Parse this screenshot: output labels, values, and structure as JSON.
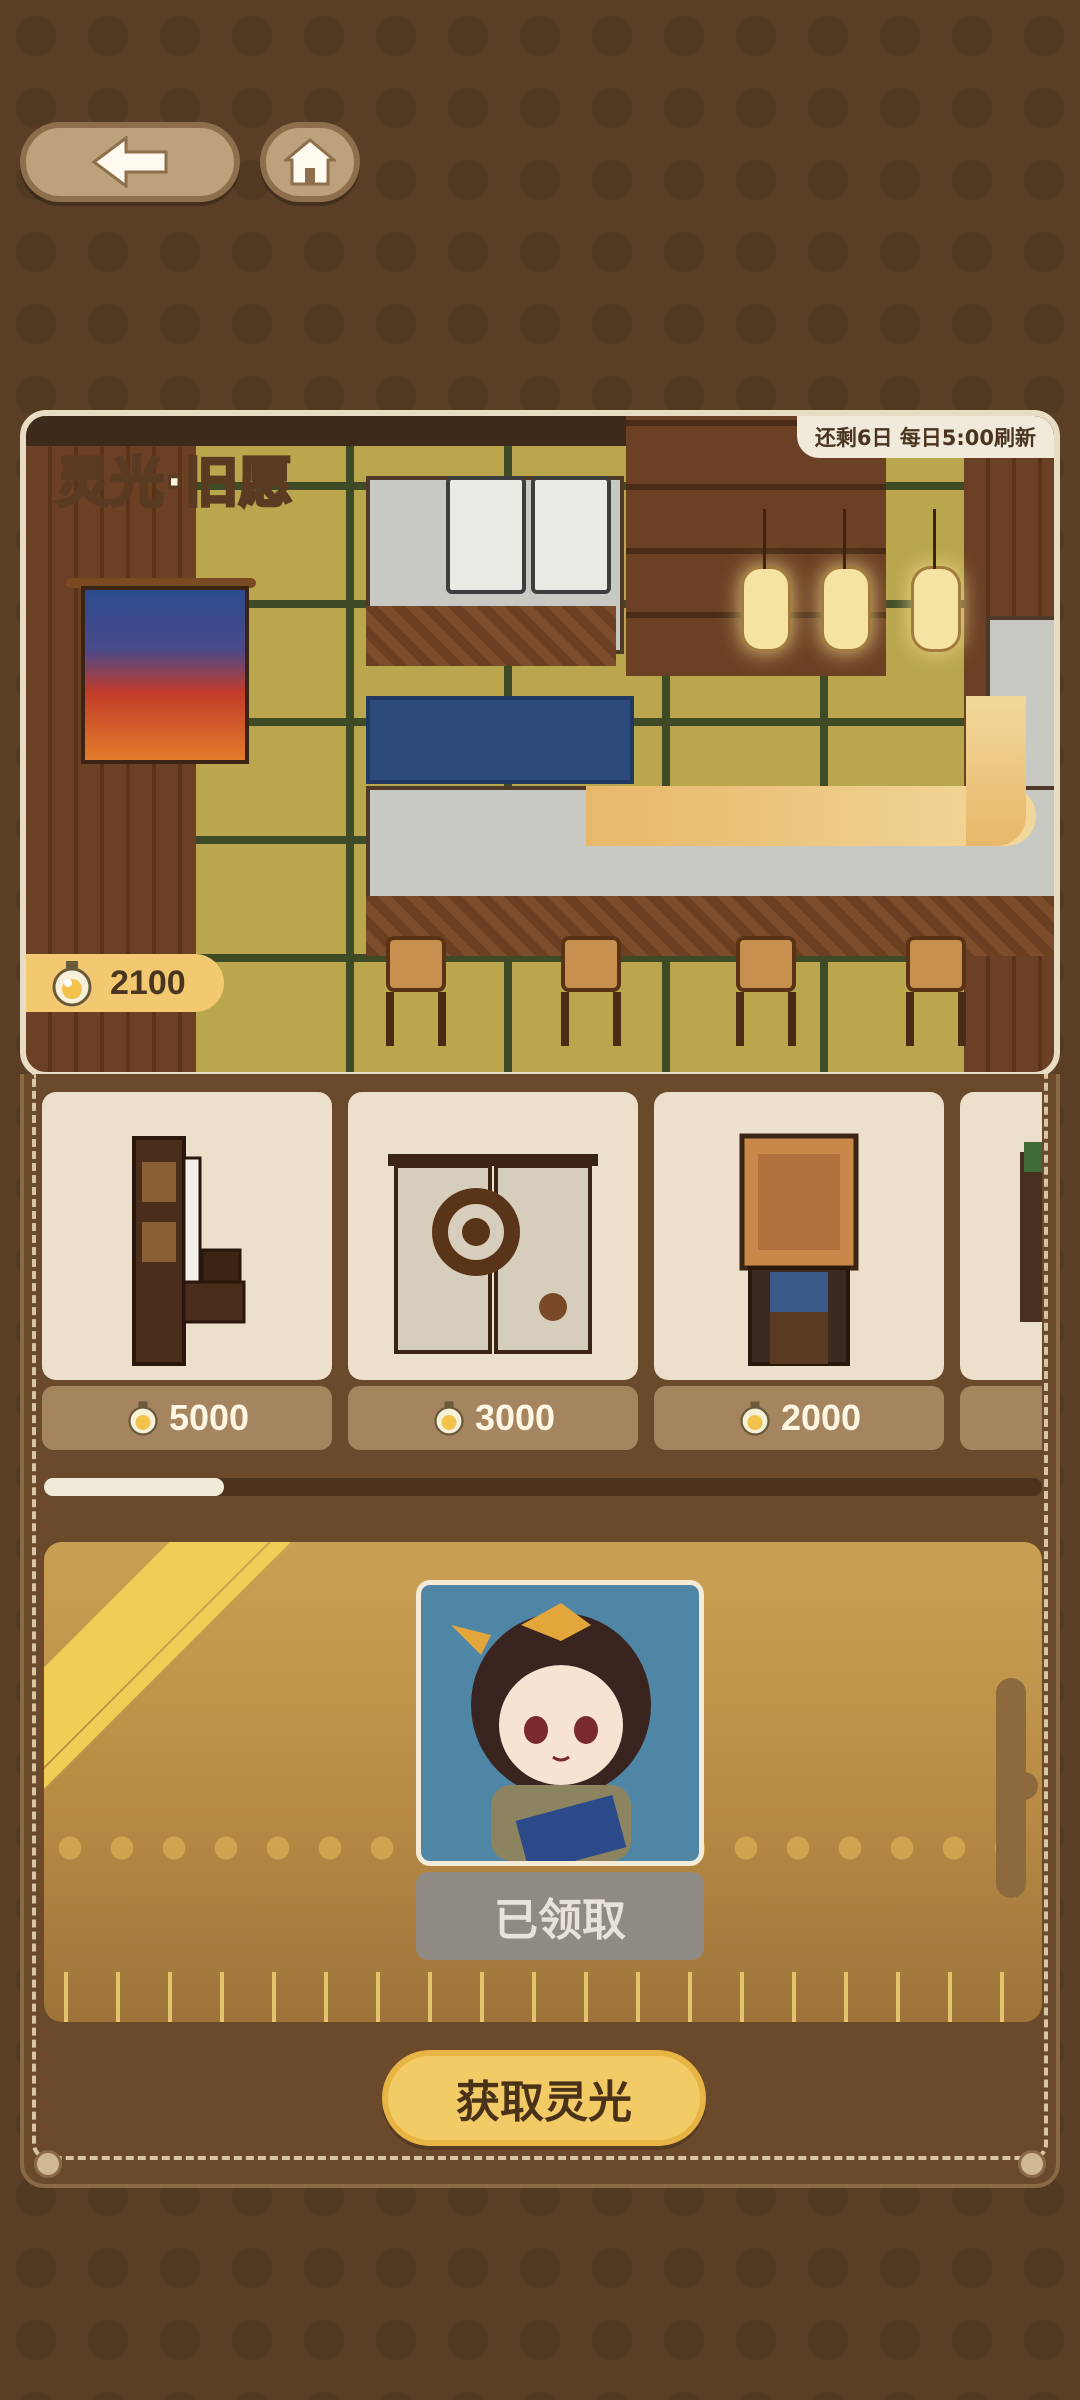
{
  "nav": {
    "back_icon": "arrow-left-icon",
    "home_icon": "home-icon"
  },
  "scene": {
    "title": "灵光·旧愿",
    "refresh_text": "还剩6日 每日5:00刷新",
    "currency_icon": "light-orb-icon",
    "currency_amount": "2100"
  },
  "shop": {
    "items": [
      {
        "name": "piano",
        "price": "5000"
      },
      {
        "name": "coffee-noren-curtain",
        "price": "3000"
      },
      {
        "name": "wooden-cabinet",
        "price": "2000"
      },
      {
        "name": "partial-item",
        "price": ""
      }
    ],
    "scroll_fraction": 0.18
  },
  "reward": {
    "status_label": "已领取"
  },
  "actions": {
    "get_light_label": "获取灵光"
  },
  "colors": {
    "background": "#5a3f26",
    "gold": "#f2cb67",
    "card": "#ece0cc",
    "price_tag": "#a58560"
  }
}
